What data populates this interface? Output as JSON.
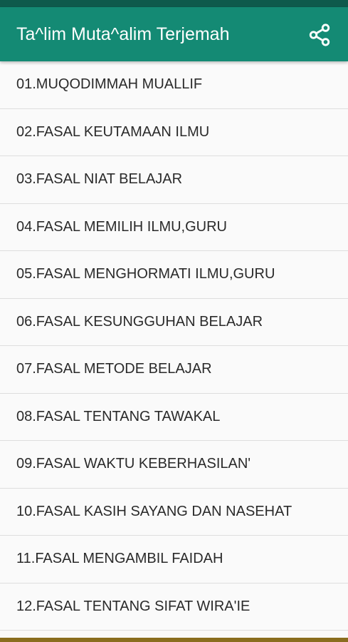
{
  "app_bar": {
    "title": "Ta^lim Muta^alim Terjemah",
    "share_icon": "share-icon"
  },
  "colors": {
    "status_bar": "#0e5a4c",
    "app_bar": "#148a74",
    "bottom_bar": "#8a6d1e",
    "list_background": "#fafafa",
    "divider": "#dedede"
  },
  "chapters": [
    "01.MUQODIMMAH MUALLIF",
    "02.FASAL KEUTAMAAN ILMU",
    "03.FASAL NIAT BELAJAR",
    "04.FASAL MEMILIH ILMU,GURU",
    "05.FASAL MENGHORMATI ILMU,GURU",
    "06.FASAL KESUNGGUHAN BELAJAR",
    "07.FASAL METODE BELAJAR",
    "08.FASAL TENTANG TAWAKAL",
    "09.FASAL WAKTU KEBERHASILAN'",
    "10.FASAL KASIH SAYANG DAN NASEHAT",
    "11.FASAL MENGAMBIL FAIDAH",
    "12.FASAL TENTANG SIFAT WIRA'IE"
  ]
}
